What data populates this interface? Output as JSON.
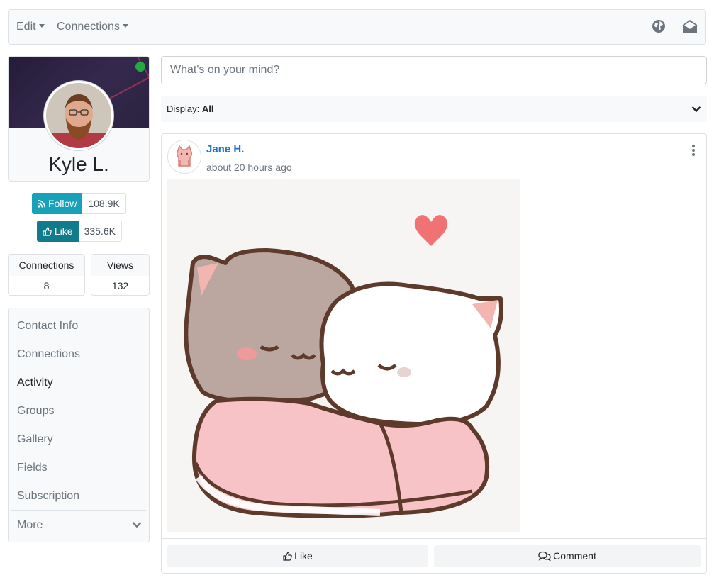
{
  "navbar": {
    "menus": [
      {
        "label": "Edit"
      },
      {
        "label": "Connections"
      }
    ],
    "icons": [
      "globe-icon",
      "envelope-open-icon"
    ]
  },
  "profile": {
    "name": "Kyle L.",
    "online": true,
    "follow_label": "Follow",
    "follow_count": "108.9K",
    "like_label": "Like",
    "like_count": "335.6K",
    "stats": [
      {
        "label": "Connections",
        "value": "8"
      },
      {
        "label": "Views",
        "value": "132"
      }
    ]
  },
  "side_nav": {
    "items": [
      {
        "label": "Contact Info",
        "active": false
      },
      {
        "label": "Connections",
        "active": false
      },
      {
        "label": "Activity",
        "active": true
      },
      {
        "label": "Groups",
        "active": false
      },
      {
        "label": "Gallery",
        "active": false
      },
      {
        "label": "Fields",
        "active": false
      },
      {
        "label": "Subscription",
        "active": false
      }
    ],
    "more_label": "More"
  },
  "composer": {
    "placeholder": "What's on your mind?"
  },
  "filter": {
    "prefix": "Display:",
    "value": "All"
  },
  "post": {
    "author": "Jane H.",
    "time": "about 20 hours ago",
    "like_label": "Like",
    "comment_label": "Comment"
  },
  "colors": {
    "follow_button": "#17a2b8",
    "like_button": "#117a8b",
    "link": "#1a73c8",
    "online": "#28a745"
  }
}
